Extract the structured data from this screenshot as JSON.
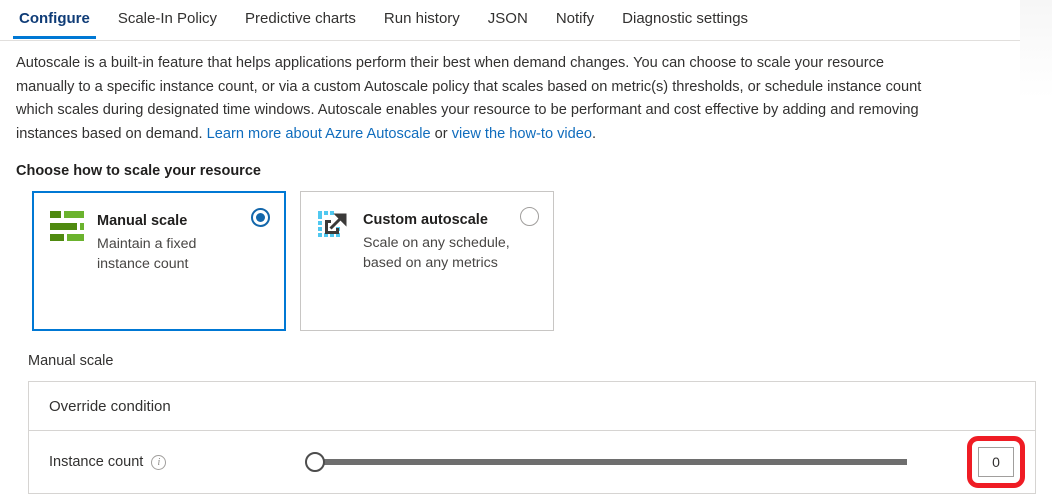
{
  "tabs": [
    {
      "label": "Configure",
      "active": true
    },
    {
      "label": "Scale-In Policy",
      "active": false
    },
    {
      "label": "Predictive charts",
      "active": false
    },
    {
      "label": "Run history",
      "active": false
    },
    {
      "label": "JSON",
      "active": false
    },
    {
      "label": "Notify",
      "active": false
    },
    {
      "label": "Diagnostic settings",
      "active": false
    }
  ],
  "description": {
    "part1": "Autoscale is a built-in feature that helps applications perform their best when demand changes. You can choose to scale your resource manually to a specific instance count, or via a custom Autoscale policy that scales based on metric(s) thresholds, or schedule instance count which scales during designated time windows. Autoscale enables your resource to be performant and cost effective by adding and removing instances based on demand. ",
    "link1": "Learn more about Azure Autoscale",
    "connector": " or ",
    "link2": "view the how-to video",
    "period": "."
  },
  "section": {
    "heading": "Choose how to scale your resource"
  },
  "cards": [
    {
      "title": "Manual scale",
      "subtitle": "Maintain a fixed instance count",
      "icon": "levels-icon",
      "selected": true
    },
    {
      "title": "Custom autoscale",
      "subtitle": "Scale on any schedule, based on any metrics",
      "icon": "expand-arrow-icon",
      "selected": false
    }
  ],
  "manual_scale": {
    "panel_label": "Manual scale",
    "override_condition_label": "Override condition",
    "instance_count_label": "Instance count",
    "instance_count_value": "0",
    "slider_position_percent": 0
  },
  "colors": {
    "accent": "#0078d4",
    "link": "#0f6cbd",
    "annotation": "#ef1c24",
    "icon_green_dark": "#4f8a10",
    "icon_green_light": "#6bb32e",
    "icon_cyan": "#50c8f0"
  }
}
